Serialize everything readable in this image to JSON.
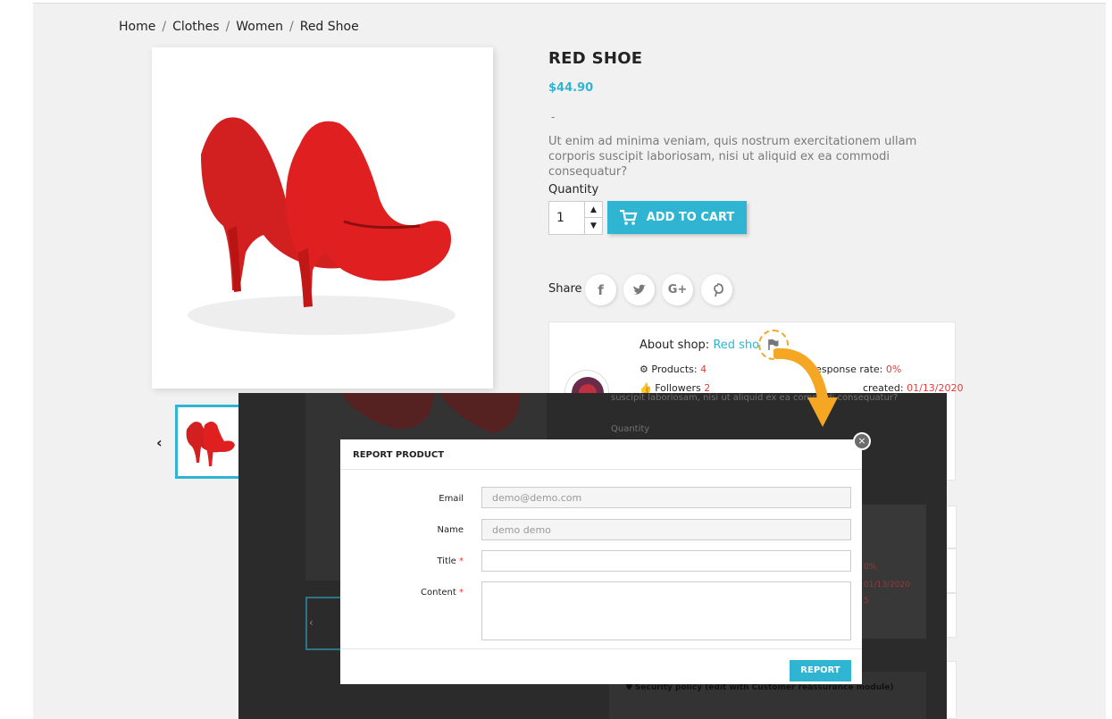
{
  "breadcrumb": {
    "items": [
      "Home",
      "Clothes",
      "Women",
      "Red Shoe"
    ],
    "separator": "/"
  },
  "product": {
    "title": "RED SHOE",
    "price": "$44.90",
    "dash": "-",
    "description": "Ut enim ad minima veniam, quis nostrum exercitationem ullam corporis suscipit laboriosam, nisi ut aliquid ex ea commodi consequatur?",
    "quantity_label": "Quantity",
    "quantity_value": "1",
    "add_to_cart_label": "ADD TO CART",
    "share_label": "Share",
    "share_buttons": [
      "f",
      "G+"
    ]
  },
  "shop": {
    "about_label": "About shop:",
    "shop_name": "Red shoe",
    "products_label": "Products:",
    "products_value": "4",
    "followers_label": "Followers",
    "followers_value": "2",
    "response_label": "Response rate:",
    "response_value": "0%",
    "created_label": "created:",
    "created_value": "01/13/2020"
  },
  "background_ghost": {
    "desc": "suscipit laboriosam, nisi ut aliquid ex ea commodi consequatur?",
    "quantity_label": "Quantity",
    "rate": "0%",
    "date": "01/13/2020",
    "count": "5",
    "security_policy": "Security policy (edit with Customer reassurance module)"
  },
  "modal": {
    "title": "REPORT PRODUCT",
    "close_glyph": "×",
    "email_label": "Email",
    "email_value": "demo@demo.com",
    "name_label": "Name",
    "name_value": "demo demo",
    "title_label": "Title",
    "content_label": "Content",
    "required_mark": "*",
    "report_button": "REPORT"
  },
  "colors": {
    "accent": "#2fb5d2",
    "highlight": "#f5a623",
    "alert": "#e23b3b",
    "overlay": "#2b2b2b"
  }
}
